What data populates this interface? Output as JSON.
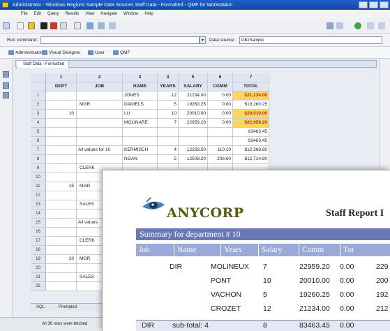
{
  "window": {
    "title": "Administrator - Windows Regions Sample Data Sources Staff Data - Formatted - QMF for Workstation"
  },
  "menu": [
    "File",
    "Edit",
    "Query",
    "Results",
    "View",
    "Navigate",
    "Window",
    "Help"
  ],
  "command_bar": {
    "run_label": "Run command:",
    "datasource_label": "Data source:",
    "datasource_value": "DB2Sample"
  },
  "perspectives": [
    "Administrator",
    "Visual Designer",
    "User",
    "QMF"
  ],
  "editor_tab": "Staff Data - Formatted",
  "grid": {
    "col_numbers": [
      "1",
      "2",
      "3",
      "4",
      "5",
      "6",
      "7"
    ],
    "headers": [
      "DEPT",
      "JOB",
      "NAME",
      "YEARS",
      "SALARY",
      "COMM",
      "TOTAL"
    ],
    "rows": [
      {
        "n": "1",
        "name": "JONES",
        "years": "12",
        "salary": "21234.00",
        "comm": "0.00",
        "total": "$21,234.00",
        "hl": true
      },
      {
        "n": "2",
        "name": "DANIELS",
        "years": "5",
        "salary": "19260.25",
        "comm": "0.00",
        "total": "$19,260.25",
        "hl": false
      },
      {
        "n": "3",
        "name": "LU",
        "years": "10",
        "salary": "20010.00",
        "comm": "0.00",
        "total": "$20,010.00",
        "hl": true
      },
      {
        "n": "4",
        "name": "MOLINARE",
        "years": "7",
        "salary": "22959.20",
        "comm": "0.00",
        "total": "$22,959.20",
        "hl": true
      },
      {
        "n": "5",
        "name": "",
        "years": "",
        "salary": "",
        "comm": "",
        "total": "83463.45",
        "hl": false
      },
      {
        "n": "6",
        "name": "",
        "years": "",
        "salary": "",
        "comm": "",
        "total": "83463.45",
        "hl": false
      },
      {
        "n": "7",
        "name": "KERMISCH",
        "years": "4",
        "salary": "12258.50",
        "comm": "110.10",
        "total": "$12,368.60",
        "hl": false
      },
      {
        "n": "8",
        "name": "NGAN",
        "years": "5",
        "salary": "12508.20",
        "comm": "206.60",
        "total": "$12,714.80",
        "hl": false
      },
      {
        "n": "9",
        "name": "",
        "years": "",
        "salary": "",
        "comm": "",
        "total": "",
        "hl": false
      },
      {
        "n": "10",
        "name": "",
        "years": "",
        "salary": "",
        "comm": "",
        "total": "",
        "hl": false
      },
      {
        "n": "11",
        "name": "",
        "years": "",
        "salary": "",
        "comm": "",
        "total": "",
        "hl": false
      },
      {
        "n": "12",
        "name": "",
        "years": "",
        "salary": "",
        "comm": "",
        "total": "",
        "hl": false
      },
      {
        "n": "13",
        "name": "",
        "years": "",
        "salary": "",
        "comm": "",
        "total": "",
        "hl": false
      },
      {
        "n": "14",
        "name": "",
        "years": "",
        "salary": "",
        "comm": "",
        "total": "",
        "hl": false
      },
      {
        "n": "15",
        "name": "",
        "years": "",
        "salary": "",
        "comm": "",
        "total": "",
        "hl": false
      },
      {
        "n": "16",
        "name": "",
        "years": "",
        "salary": "",
        "comm": "",
        "total": "",
        "hl": false
      },
      {
        "n": "17",
        "name": "",
        "years": "",
        "salary": "",
        "comm": "",
        "total": "",
        "hl": false
      },
      {
        "n": "18",
        "name": "",
        "years": "",
        "salary": "",
        "comm": "",
        "total": "",
        "hl": false
      },
      {
        "n": "19",
        "name": "",
        "years": "",
        "salary": "",
        "comm": "",
        "total": "",
        "hl": false
      },
      {
        "n": "20",
        "name": "",
        "years": "",
        "salary": "",
        "comm": "",
        "total": "",
        "hl": false
      },
      {
        "n": "21",
        "name": "",
        "years": "",
        "salary": "",
        "comm": "",
        "total": "",
        "hl": false
      },
      {
        "n": "22",
        "name": "",
        "years": "",
        "salary": "",
        "comm": "",
        "total": "",
        "hl": false
      }
    ],
    "dept_labels": [
      "10",
      "15",
      "20"
    ],
    "job_labels": [
      "MGR",
      "CLERK",
      "MGR",
      "SALES",
      "CLERK",
      "MGR",
      "SALES"
    ],
    "all_values_label": "All values for 10",
    "all_values_label_2": "All values"
  },
  "bottom_tabs": [
    "SQL",
    "Prompted"
  ],
  "status_text": "All 36 rows were fetched",
  "report": {
    "company": "ANYCORP",
    "title": "Staff Report I",
    "summary": "Summary for department # 10",
    "columns": [
      "Job",
      "Name",
      "Years",
      "Salary",
      "Comm",
      "Tot"
    ],
    "job": "DIR",
    "rows": [
      {
        "name": "MOLINEUX",
        "years": "7",
        "salary": "22959.20",
        "comm": "0.00",
        "total": "229"
      },
      {
        "name": "PONT",
        "years": "10",
        "salary": "20010.00",
        "comm": "0.00",
        "total": "200"
      },
      {
        "name": "VACHON",
        "years": "5",
        "salary": "19260.25",
        "comm": "0.00",
        "total": "192"
      },
      {
        "name": "CROZET",
        "years": "12",
        "salary": "21234.00",
        "comm": "0.00",
        "total": "212"
      }
    ],
    "subtotal": {
      "job": "DIR",
      "label": "sub-total: 4",
      "years": "8",
      "salary": "83463.45",
      "comm": "0.00"
    }
  }
}
